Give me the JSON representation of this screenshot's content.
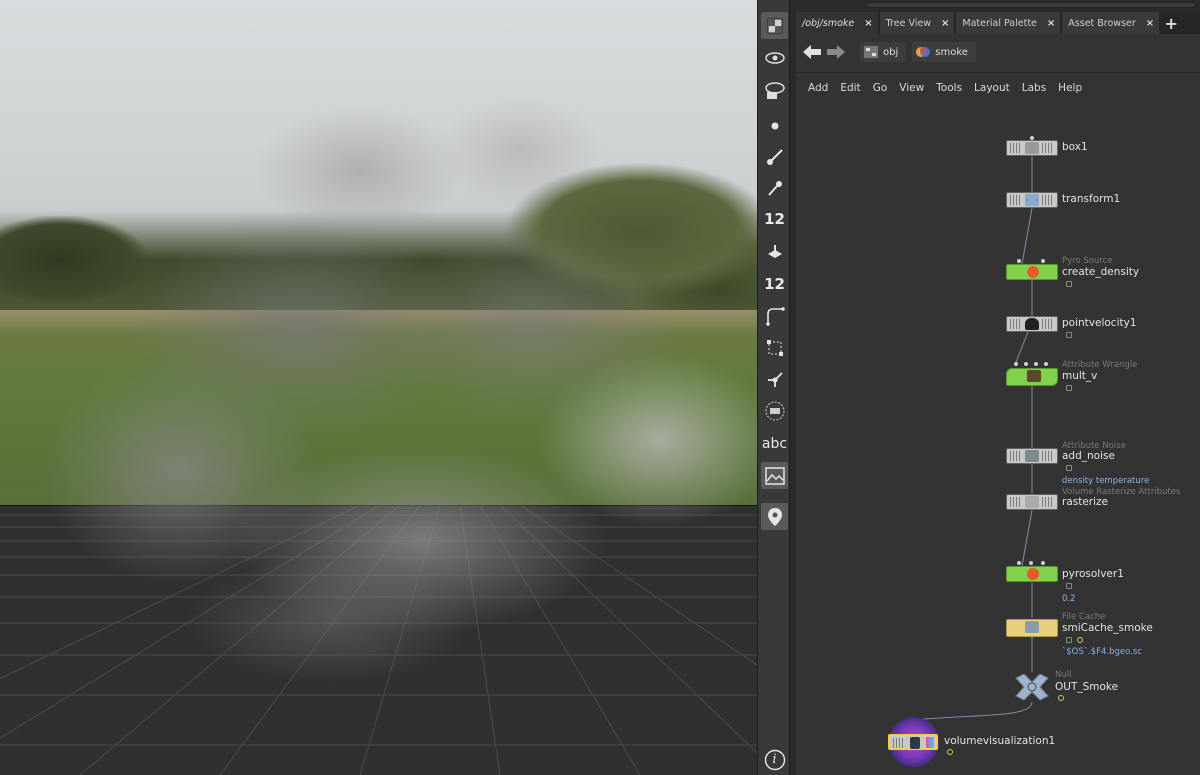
{
  "tabs": [
    {
      "label": "/obj/smoke",
      "active": true
    },
    {
      "label": "Tree View",
      "active": false
    },
    {
      "label": "Material Palette",
      "active": false
    },
    {
      "label": "Asset Browser",
      "active": false
    }
  ],
  "tab_add_label": "+",
  "breadcrumb": {
    "root": "obj",
    "current": "smoke"
  },
  "menu": [
    "Add",
    "Edit",
    "Go",
    "View",
    "Tools",
    "Layout",
    "Labs",
    "Help"
  ],
  "toolbar": {
    "count_label_1": "12",
    "count_label_2": "12",
    "text_tool_label": "abc",
    "info_label": "i"
  },
  "nodes": [
    {
      "name": "box1",
      "type": "",
      "params": ""
    },
    {
      "name": "transform1",
      "type": "",
      "params": ""
    },
    {
      "name": "create_density",
      "type": "Pyro Source",
      "params": ""
    },
    {
      "name": "pointvelocity1",
      "type": "",
      "params": ""
    },
    {
      "name": "mult_v",
      "type": "Attribute Wrangle",
      "params": ""
    },
    {
      "name": "add_noise",
      "type": "Attribute Noise",
      "params": "density temperature"
    },
    {
      "name": "rasterize",
      "type": "Volume Rasterize Attributes",
      "params": ""
    },
    {
      "name": "pyrosolver1",
      "type": "",
      "params": "0.2"
    },
    {
      "name": "smiCache_smoke",
      "type": "File Cache",
      "params": "`$OS`.$F4.bgeo.sc"
    },
    {
      "name": "OUT_Smoke",
      "type": "Null",
      "params": ""
    },
    {
      "name": "volumevisualization1",
      "type": "",
      "params": ""
    }
  ],
  "colors": {
    "pane_bg": "#333333",
    "node_default": "#c8c8c8",
    "node_green": "#7fd24a",
    "node_yellow": "#e8cf7c",
    "param_blue": "#8fb4e8",
    "display_flag": "#b8d84a"
  }
}
